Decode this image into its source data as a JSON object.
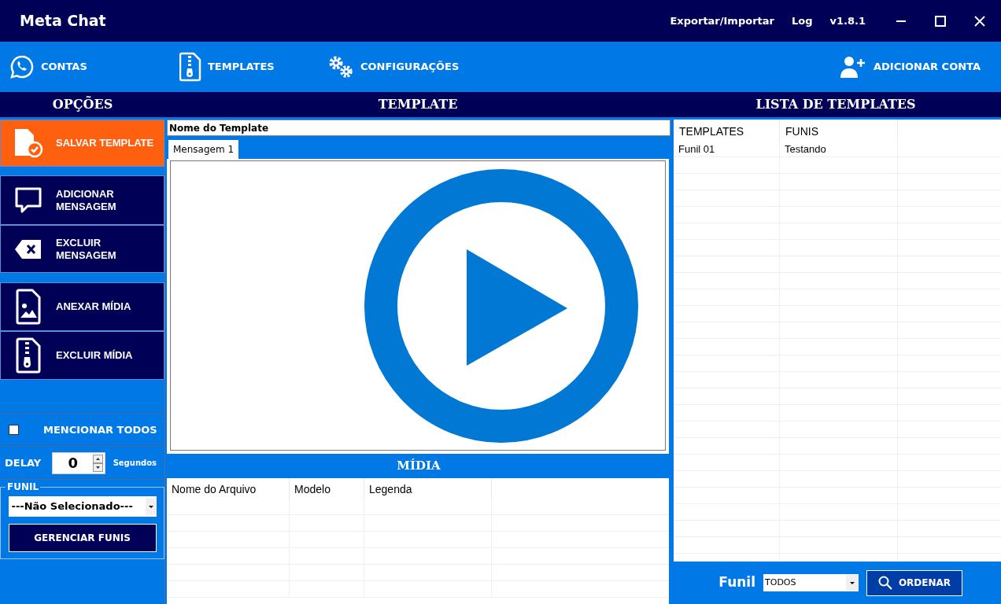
{
  "window": {
    "title": "Meta Chat",
    "menu": [
      "Exportar/Importar",
      "Log"
    ],
    "version": "v1.8.1"
  },
  "nav": [
    {
      "kind": "whatsapp",
      "label": "CONTAS"
    },
    {
      "kind": "zip",
      "label": "TEMPLATES"
    },
    {
      "kind": "gears",
      "label": "CONFIGURAÇÕES"
    }
  ],
  "add_account": "ADICIONAR CONTA",
  "headers": {
    "options": "OPÇÕES",
    "template": "TEMPLATE",
    "list": "LISTA DE TEMPLATES"
  },
  "actions": [
    {
      "kind": "save",
      "label": "SALVAR TEMPLATE",
      "primary": true
    },
    {
      "kind": "message",
      "label": "ADICIONAR MENSAGEM",
      "primary": false
    },
    {
      "kind": "delete",
      "label": "EXCLUIR MENSAGEM",
      "primary": false
    },
    {
      "kind": "image",
      "label": "ANEXAR MÍDIA",
      "primary": false
    },
    {
      "kind": "zip",
      "label": "EXCLUIR MÍDIA",
      "primary": false
    }
  ],
  "mention_all": {
    "label": "MENCIONAR TODOS",
    "checked": false
  },
  "delay": {
    "label": "DELAY",
    "value": "0",
    "unit": "Segundos"
  },
  "funnel": {
    "legend": "FUNIL",
    "value": "---Não Selecionado---",
    "manage": "GERENCIAR FUNIS"
  },
  "template_name": {
    "value": "Nome do Template"
  },
  "tabs": [
    {
      "label": "Mensagem 1",
      "selected": true
    }
  ],
  "media": {
    "title": "MÍDIA",
    "columns": [
      "Nome do Arquivo",
      "Modelo",
      "Legenda"
    ]
  },
  "templates_table": {
    "columns": [
      "TEMPLATES",
      "FUNIS"
    ],
    "rows": [
      [
        "Funil 01",
        "Testando"
      ]
    ]
  },
  "filter": {
    "label": "Funil",
    "value": "TODOS",
    "button": "ORDENAR"
  }
}
